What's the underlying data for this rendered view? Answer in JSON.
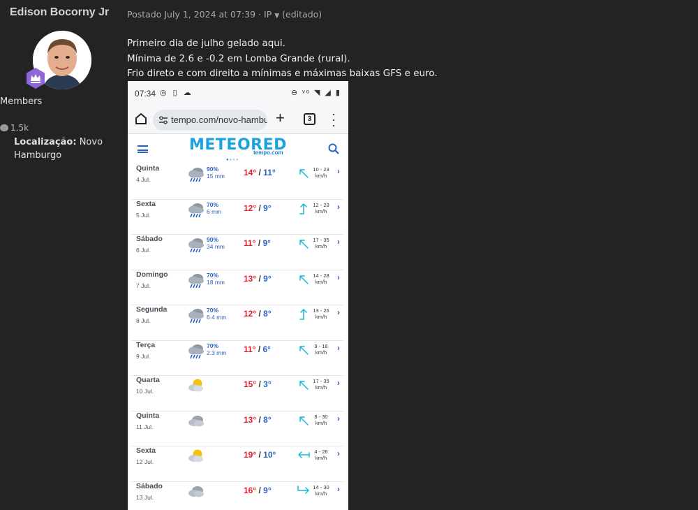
{
  "author": {
    "name": "Edison Bocorny Jr",
    "group": "Members",
    "reputation": "1.5k",
    "location_label": "Localização:",
    "location_value": "Novo Hamburgo"
  },
  "meta": {
    "posted": "Postado July 1, 2024 at 07:39",
    "separator": "·",
    "ip": "IP",
    "edited": "(editado)"
  },
  "post": {
    "lines": [
      "Primeiro dia de julho gelado aqui.",
      "Mínima de 2.6 e -0.2 em Lomba Grande (rural).",
      "Frio direto e com direito a mínimas e máximas baixas GFS e euro."
    ]
  },
  "phone": {
    "status_time": "07:34",
    "url": "tempo.com/novo-hamburgo",
    "tab_count": "3",
    "logo": "METEORED",
    "logo_sub": "tempo.com",
    "forecast": [
      {
        "day": "Quinta",
        "date": "4 Jul.",
        "icon": "rain-cloud-icon",
        "pct": "90%",
        "mm": "15 mm",
        "max": "14°",
        "min": "11°",
        "wind": "10 - 23",
        "unit": "km/h",
        "dir": "nw"
      },
      {
        "day": "Sexta",
        "date": "5 Jul.",
        "icon": "rain-cloud-icon",
        "pct": "70%",
        "mm": "6 mm",
        "max": "12°",
        "min": "9°",
        "wind": "12 - 23",
        "unit": "km/h",
        "dir": "n"
      },
      {
        "day": "Sábado",
        "date": "6 Jul.",
        "icon": "rain-cloud-icon",
        "pct": "90%",
        "mm": "34 mm",
        "max": "11°",
        "min": "9°",
        "wind": "17 - 35",
        "unit": "km/h",
        "dir": "nw"
      },
      {
        "day": "Domingo",
        "date": "7 Jul.",
        "icon": "rain-cloud-icon",
        "pct": "70%",
        "mm": "18 mm",
        "max": "13°",
        "min": "9°",
        "wind": "14 - 28",
        "unit": "km/h",
        "dir": "nw"
      },
      {
        "day": "Segunda",
        "date": "8 Jul.",
        "icon": "rain-cloud-icon",
        "pct": "70%",
        "mm": "6.4 mm",
        "max": "12°",
        "min": "8°",
        "wind": "13 - 26",
        "unit": "km/h",
        "dir": "n"
      },
      {
        "day": "Terça",
        "date": "9 Jul.",
        "icon": "rain-cloud-icon",
        "pct": "70%",
        "mm": "2.3 mm",
        "max": "11°",
        "min": "6°",
        "wind": "9 - 18",
        "unit": "km/h",
        "dir": "nw"
      },
      {
        "day": "Quarta",
        "date": "10 Jul.",
        "icon": "sun-cloud-icon",
        "pct": "",
        "mm": "",
        "max": "15°",
        "min": "3°",
        "wind": "17 - 35",
        "unit": "km/h",
        "dir": "nw"
      },
      {
        "day": "Quinta",
        "date": "11 Jul.",
        "icon": "cloud-icon",
        "pct": "",
        "mm": "",
        "max": "13°",
        "min": "8°",
        "wind": "8 - 30",
        "unit": "km/h",
        "dir": "nw"
      },
      {
        "day": "Sexta",
        "date": "12 Jul.",
        "icon": "sun-cloud-icon",
        "pct": "",
        "mm": "",
        "max": "19°",
        "min": "10°",
        "wind": "4 - 28",
        "unit": "km/h",
        "dir": "w"
      },
      {
        "day": "Sábado",
        "date": "13 Jul.",
        "icon": "cloud-icon",
        "pct": "",
        "mm": "",
        "max": "16°",
        "min": "9°",
        "wind": "14 - 30",
        "unit": "km/h",
        "dir": "e"
      }
    ]
  },
  "colors": {
    "background": "#232323",
    "max_temp": "#e2202d",
    "min_temp": "#2a62c0",
    "wind_arrow": "#17b8d8",
    "brand": "#1aa3df"
  }
}
